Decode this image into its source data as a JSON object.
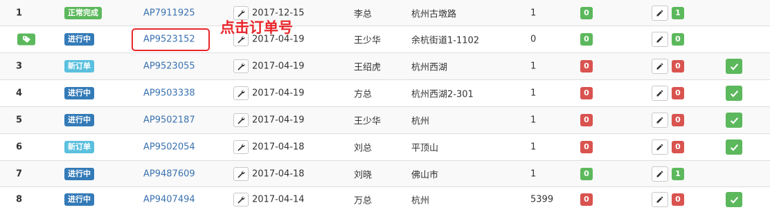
{
  "colors": {
    "status_done": "#5cb85c",
    "status_inprogress": "#337ab7",
    "status_new": "#5bc0de",
    "count_green": "#5cb85c",
    "count_red": "#d9534f",
    "link": "#3a72b0",
    "annotation": "#e8262a"
  },
  "annotation": {
    "text": "点击订单号"
  },
  "rows": [
    {
      "index": "1",
      "status": "正常完成",
      "status_type": "done",
      "order": "AP7911925",
      "date": "2017-12-15",
      "customer": "李总",
      "address": "杭州古墩路",
      "qty": "1",
      "count1": "0",
      "count1_type": "green",
      "count2": "1",
      "count2_type": "green",
      "confirm": false
    },
    {
      "index": "",
      "status": "进行中",
      "status_type": "inprogress",
      "order": "AP9523152",
      "date": "2017-04-19",
      "customer": "王少华",
      "address": "余杭街道1-1102",
      "qty": "0",
      "count1": "0",
      "count1_type": "green",
      "count2": "0",
      "count2_type": "green",
      "confirm": false,
      "tag_icon": true
    },
    {
      "index": "3",
      "status": "新订单",
      "status_type": "new",
      "order": "AP9523055",
      "date": "2017-04-19",
      "customer": "王绍虎",
      "address": "杭州西湖",
      "qty": "1",
      "count1": "0",
      "count1_type": "red",
      "count2": "0",
      "count2_type": "red",
      "confirm": true
    },
    {
      "index": "4",
      "status": "进行中",
      "status_type": "inprogress",
      "order": "AP9503338",
      "date": "2017-04-19",
      "customer": "方总",
      "address": "杭州西湖2-301",
      "qty": "1",
      "count1": "0",
      "count1_type": "red",
      "count2": "0",
      "count2_type": "red",
      "confirm": true
    },
    {
      "index": "5",
      "status": "进行中",
      "status_type": "inprogress",
      "order": "AP9502187",
      "date": "2017-04-19",
      "customer": "王少华",
      "address": "杭州",
      "qty": "1",
      "count1": "0",
      "count1_type": "red",
      "count2": "0",
      "count2_type": "red",
      "confirm": true
    },
    {
      "index": "6",
      "status": "新订单",
      "status_type": "new",
      "order": "AP9502054",
      "date": "2017-04-18",
      "customer": "刘总",
      "address": "平顶山",
      "qty": "1",
      "count1": "0",
      "count1_type": "red",
      "count2": "0",
      "count2_type": "red",
      "confirm": true
    },
    {
      "index": "7",
      "status": "进行中",
      "status_type": "inprogress",
      "order": "AP9487609",
      "date": "2017-04-18",
      "customer": "刘晓",
      "address": "佛山市",
      "qty": "1",
      "count1": "0",
      "count1_type": "green",
      "count2": "1",
      "count2_type": "green",
      "confirm": false
    },
    {
      "index": "8",
      "status": "进行中",
      "status_type": "inprogress",
      "order": "AP9407494",
      "date": "2017-04-14",
      "customer": "万总",
      "address": "杭州",
      "qty": "5399",
      "count1": "0",
      "count1_type": "red",
      "count2": "0",
      "count2_type": "red",
      "confirm": true
    }
  ]
}
